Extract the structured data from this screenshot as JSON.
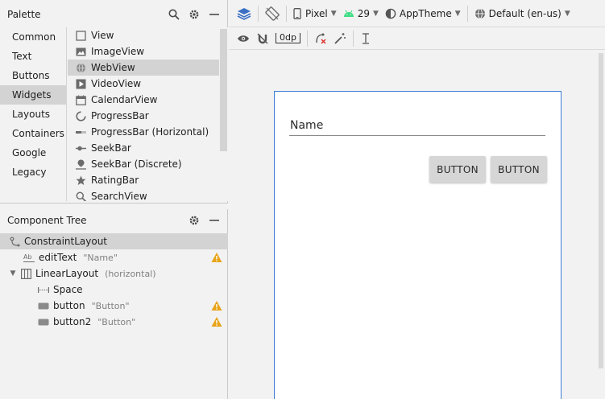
{
  "palette": {
    "title": "Palette",
    "categories": [
      "Common",
      "Text",
      "Buttons",
      "Widgets",
      "Layouts",
      "Containers",
      "Google",
      "Legacy"
    ],
    "selected_category": "Widgets",
    "items": [
      "View",
      "ImageView",
      "WebView",
      "VideoView",
      "CalendarView",
      "ProgressBar",
      "ProgressBar (Horizontal)",
      "SeekBar",
      "SeekBar (Discrete)",
      "RatingBar",
      "SearchView"
    ],
    "selected_item": "WebView"
  },
  "component_tree": {
    "title": "Component Tree",
    "root": "ConstraintLayout",
    "nodes": [
      {
        "label": "editText",
        "hint": "\"Name\"",
        "warning": true
      },
      {
        "label": "LinearLayout",
        "hint": "(horizontal)",
        "warning": false
      },
      {
        "label": "Space",
        "hint": "",
        "warning": false
      },
      {
        "label": "button",
        "hint": "\"Button\"",
        "warning": true
      },
      {
        "label": "button2",
        "hint": "\"Button\"",
        "warning": true
      }
    ]
  },
  "toolbar": {
    "device": "Pixel",
    "api_level": "29",
    "theme": "AppTheme",
    "locale": "Default (en-us)",
    "default_margin": "0dp"
  },
  "design": {
    "name_field_text": "Name",
    "button1_label": "BUTTON",
    "button2_label": "BUTTON"
  },
  "colors": {
    "selection": "#d3d3d3",
    "warning": "#e8a317",
    "device_border": "#3d7cd6",
    "android_green": "#3ddc84",
    "layers_blue": "#3a6fc4"
  }
}
